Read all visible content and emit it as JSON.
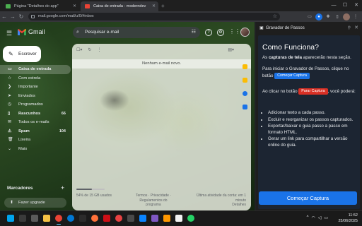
{
  "browser": {
    "tabs": [
      {
        "title": "Página \"Detalhes do app\"",
        "active": false
      },
      {
        "title": "Caixa de entrada - moderndev",
        "active": true
      }
    ],
    "url": "mail.google.com/mail/u/0/#inbox"
  },
  "gmail": {
    "app_name": "Gmail",
    "search_placeholder": "Pesquisar e-mail",
    "compose_label": "Escrever",
    "nav": [
      {
        "label": "Caixa de entrada",
        "icon": "inbox-icon",
        "count": "",
        "selected": true,
        "bold": true
      },
      {
        "label": "Com estrela",
        "icon": "star-icon",
        "count": "",
        "selected": false,
        "bold": false
      },
      {
        "label": "Importante",
        "icon": "important-icon",
        "count": "",
        "selected": false,
        "bold": false
      },
      {
        "label": "Enviados",
        "icon": "send-icon",
        "count": "",
        "selected": false,
        "bold": false
      },
      {
        "label": "Programados",
        "icon": "scheduled-icon",
        "count": "",
        "selected": false,
        "bold": false
      },
      {
        "label": "Rascunhos",
        "icon": "draft-icon",
        "count": "66",
        "selected": false,
        "bold": true
      },
      {
        "label": "Todos os e-mails",
        "icon": "all-mail-icon",
        "count": "",
        "selected": false,
        "bold": false
      },
      {
        "label": "Spam",
        "icon": "spam-icon",
        "count": "104",
        "selected": false,
        "bold": true
      },
      {
        "label": "Lixeira",
        "icon": "trash-icon",
        "count": "",
        "selected": false,
        "bold": false
      },
      {
        "label": "Mais",
        "icon": "chevron-down-icon",
        "count": "",
        "selected": false,
        "bold": false
      }
    ],
    "labels_heading": "Marcadores",
    "upgrade_label": "Fazer upgrade",
    "empty_message": "Nenhum e-mail novo.",
    "storage_text": "54% de 15 GB usados",
    "storage_fraction": 0.54,
    "footer_links_1": "Termos · Privacidade ·",
    "footer_links_2": "Regulamentos do programa",
    "last_activity_1": "Última atividade da conta: em 1",
    "last_activity_2": "minuto",
    "last_activity_3": "Detalhes"
  },
  "sidepanel": {
    "title": "Gravador de Passos",
    "heading": "Como Funciona?",
    "intro_pre": "As ",
    "intro_bold": "capturas de tela",
    "intro_post": " aparecerão nesta seção.",
    "start_text": "Para iniciar o Gravador de Passos, clique no botão ",
    "start_pill": "Começar Captura",
    "stop_text_pre": "Ao clicar no botão ",
    "stop_pill": "Parar Captura",
    "stop_text_post": ", você poderá:",
    "bullets": [
      "Adicionar texto a cada passo.",
      "Excluir e reorganizar os passos capturados.",
      "Exportar/baixar o guia passo a passo em formato HTML.",
      "Gerar um link para compartilhar a versão online do guia."
    ],
    "start_button": "Começar Captura"
  },
  "taskbar": {
    "time": "11:52",
    "date": "25/06/2025"
  }
}
